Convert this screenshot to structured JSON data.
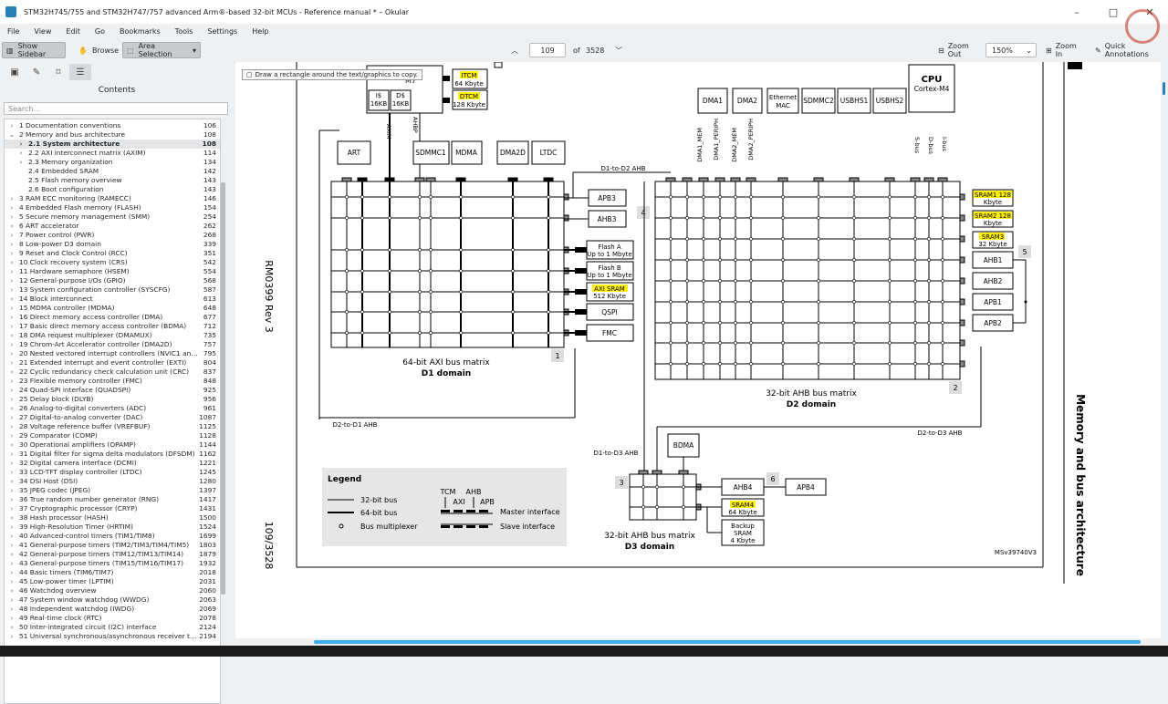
{
  "window": {
    "title": "STM32H745/755 and STM32H747/757 advanced Arm®-based 32-bit MCUs - Reference manual * – Okular",
    "minimize": "–",
    "maximize": "□",
    "close": "✕"
  },
  "menu": [
    "File",
    "View",
    "Edit",
    "Go",
    "Bookmarks",
    "Tools",
    "Settings",
    "Help"
  ],
  "toolbar": {
    "show_sidebar": "Show Sidebar",
    "browse": "Browse",
    "area_selection": "Area Selection",
    "page_current": "109",
    "page_of": "of",
    "page_total": "3528",
    "zoom_out": "Zoom Out",
    "zoom_value": "150%",
    "zoom_in": "Zoom In",
    "quick_annotations": "Quick Annotations"
  },
  "sidebar": {
    "header": "Contents",
    "search_placeholder": "Search...",
    "toc": [
      {
        "label": "1 Documentation conventions",
        "page": "106",
        "arrow": "›",
        "indent": 0
      },
      {
        "label": "2 Memory and bus architecture",
        "page": "108",
        "arrow": "⌄",
        "indent": 0
      },
      {
        "label": "2.1 System architecture",
        "page": "108",
        "arrow": "›",
        "indent": 1,
        "bold": true
      },
      {
        "label": "2.2 AXI interconnect matrix (AXIM)",
        "page": "114",
        "arrow": "›",
        "indent": 1
      },
      {
        "label": "2.3 Memory organization",
        "page": "134",
        "arrow": "›",
        "indent": 1
      },
      {
        "label": "2.4 Embedded SRAM",
        "page": "142",
        "arrow": "",
        "indent": 1
      },
      {
        "label": "2.5 Flash memory overview",
        "page": "143",
        "arrow": "",
        "indent": 1
      },
      {
        "label": "2.6 Boot configuration",
        "page": "143",
        "arrow": "",
        "indent": 1
      },
      {
        "label": "3 RAM ECC monitoring (RAMECC)",
        "page": "146",
        "arrow": "›",
        "indent": 0
      },
      {
        "label": "4 Embedded Flash memory (FLASH)",
        "page": "154",
        "arrow": "›",
        "indent": 0
      },
      {
        "label": "5 Secure memory management (SMM)",
        "page": "254",
        "arrow": "›",
        "indent": 0
      },
      {
        "label": "6 ART accelerator",
        "page": "262",
        "arrow": "›",
        "indent": 0
      },
      {
        "label": "7 Power control (PWR)",
        "page": "268",
        "arrow": "›",
        "indent": 0
      },
      {
        "label": "8 Low-power D3 domain",
        "page": "339",
        "arrow": "›",
        "indent": 0
      },
      {
        "label": "9 Reset and Clock Control (RCC)",
        "page": "351",
        "arrow": "›",
        "indent": 0
      },
      {
        "label": "10 Clock recovery system (CRS)",
        "page": "542",
        "arrow": "›",
        "indent": 0
      },
      {
        "label": "11 Hardware semaphore (HSEM)",
        "page": "554",
        "arrow": "›",
        "indent": 0
      },
      {
        "label": "12 General-purpose I/Os (GPIO)",
        "page": "568",
        "arrow": "›",
        "indent": 0
      },
      {
        "label": "13 System configuration controller (SYSCFG)",
        "page": "587",
        "arrow": "›",
        "indent": 0
      },
      {
        "label": "14 Block interconnect",
        "page": "613",
        "arrow": "›",
        "indent": 0
      },
      {
        "label": "15 MDMA controller (MDMA)",
        "page": "648",
        "arrow": "›",
        "indent": 0
      },
      {
        "label": "16 Direct memory access controller (DMA)",
        "page": "677",
        "arrow": "›",
        "indent": 0
      },
      {
        "label": "17 Basic direct memory access controller (BDMA)",
        "page": "712",
        "arrow": "›",
        "indent": 0
      },
      {
        "label": "18 DMA request multiplexer (DMAMUX)",
        "page": "735",
        "arrow": "›",
        "indent": 0
      },
      {
        "label": "19 Chrom-Art Accelerator controller (DMA2D)",
        "page": "757",
        "arrow": "›",
        "indent": 0
      },
      {
        "label": "20 Nested vectored interrupt controllers (NVIC1 and ...",
        "page": "795",
        "arrow": "›",
        "indent": 0
      },
      {
        "label": "21 Extended interrupt and event controller (EXTI)",
        "page": "804",
        "arrow": "›",
        "indent": 0
      },
      {
        "label": "22 Cyclic redundancy check calculation unit (CRC)",
        "page": "837",
        "arrow": "›",
        "indent": 0
      },
      {
        "label": "23 Flexible memory controller (FMC)",
        "page": "848",
        "arrow": "›",
        "indent": 0
      },
      {
        "label": "24 Quad-SPI interface (QUADSPI)",
        "page": "925",
        "arrow": "›",
        "indent": 0
      },
      {
        "label": "25 Delay block (DLYB)",
        "page": "956",
        "arrow": "›",
        "indent": 0
      },
      {
        "label": "26 Analog-to-digital converters (ADC)",
        "page": "961",
        "arrow": "›",
        "indent": 0
      },
      {
        "label": "27 Digital-to-analog converter (DAC)",
        "page": "1087",
        "arrow": "›",
        "indent": 0
      },
      {
        "label": "28 Voltage reference buffer (VREFBUF)",
        "page": "1125",
        "arrow": "›",
        "indent": 0
      },
      {
        "label": "29 Comparator (COMP)",
        "page": "1128",
        "arrow": "›",
        "indent": 0
      },
      {
        "label": "30 Operational amplifiers (OPAMP)",
        "page": "1144",
        "arrow": "›",
        "indent": 0
      },
      {
        "label": "31 Digital filter for sigma delta modulators (DFSDM)",
        "page": "1162",
        "arrow": "›",
        "indent": 0
      },
      {
        "label": "32 Digital camera interface (DCMI)",
        "page": "1221",
        "arrow": "›",
        "indent": 0
      },
      {
        "label": "33 LCD-TFT display controller (LTDC)",
        "page": "1245",
        "arrow": "›",
        "indent": 0
      },
      {
        "label": "34 DSI Host (DSI)",
        "page": "1280",
        "arrow": "›",
        "indent": 0
      },
      {
        "label": "35 JPEG codec (JPEG)",
        "page": "1397",
        "arrow": "›",
        "indent": 0
      },
      {
        "label": "36 True random number generator (RNG)",
        "page": "1417",
        "arrow": "›",
        "indent": 0
      },
      {
        "label": "37 Cryptographic processor (CRYP)",
        "page": "1431",
        "arrow": "›",
        "indent": 0
      },
      {
        "label": "38 Hash processor (HASH)",
        "page": "1500",
        "arrow": "›",
        "indent": 0
      },
      {
        "label": "39 High-Resolution Timer (HRTIM)",
        "page": "1524",
        "arrow": "›",
        "indent": 0
      },
      {
        "label": "40 Advanced-control timers (TIM1/TIM8)",
        "page": "1699",
        "arrow": "›",
        "indent": 0
      },
      {
        "label": "41 General-purpose timers (TIM2/TIM3/TIM4/TIM5)",
        "page": "1803",
        "arrow": "›",
        "indent": 0
      },
      {
        "label": "42 General-purpose timers (TIM12/TIM13/TIM14)",
        "page": "1879",
        "arrow": "›",
        "indent": 0
      },
      {
        "label": "43 General-purpose timers (TIM15/TIM16/TIM17)",
        "page": "1932",
        "arrow": "›",
        "indent": 0
      },
      {
        "label": "44 Basic timers (TIM6/TIM7)",
        "page": "2018",
        "arrow": "›",
        "indent": 0
      },
      {
        "label": "45 Low-power timer (LPTIM)",
        "page": "2031",
        "arrow": "›",
        "indent": 0
      },
      {
        "label": "46 Watchdog overview",
        "page": "2060",
        "arrow": "›",
        "indent": 0
      },
      {
        "label": "47 System window watchdog (WWDG)",
        "page": "2063",
        "arrow": "›",
        "indent": 0
      },
      {
        "label": "48 Independent watchdog (IWDG)",
        "page": "2069",
        "arrow": "›",
        "indent": 0
      },
      {
        "label": "49 Real-time clock (RTC)",
        "page": "2078",
        "arrow": "›",
        "indent": 0
      },
      {
        "label": "50 Inter-integrated circuit (I2C) interface",
        "page": "2124",
        "arrow": "›",
        "indent": 0
      },
      {
        "label": "51 Universal synchronous/asynchronous receiver tra...",
        "page": "2194",
        "arrow": "›",
        "indent": 0
      }
    ]
  },
  "tooltip": "Draw a rectangle around the text/graphics to copy.",
  "document": {
    "margin_left_top": "RM0399 Rev 3",
    "margin_left_bottom": "109/3528",
    "margin_right": "Memory and bus architecture",
    "diagram_id": "MSv39740V3",
    "cpu_m7": "M7",
    "itcm": "ITCM",
    "itcm_size": "64 Kbyte",
    "dtcm": "DTCM",
    "dtcm_size": "128 Kbyte",
    "icache": "I$",
    "icache_size": "16KB",
    "dcache": "D$",
    "dcache_size": "16KB",
    "axim": "AXIM",
    "ahbp": "AHBP",
    "art": "ART",
    "sdmmc1": "SDMMC1",
    "mdma": "MDMA",
    "dma2d": "DMA2D",
    "ltdc": "LTDC",
    "apb3": "APB3",
    "ahb3": "AHB3",
    "flash_a": "Flash A",
    "flash_a_size": "Up to 1 Mbyte",
    "flash_b": "Flash B",
    "flash_b_size": "Up to 1 Mbyte",
    "axi_sram": "AXI SRAM",
    "axi_sram_size": "512 Kbyte",
    "qspi": "QSPI",
    "fmc": "FMC",
    "d1_title": "64-bit AXI bus matrix",
    "d1_domain": "D1 domain",
    "d1_to_d2": "D1-to-D2 AHB",
    "d2_to_d1": "D2-to-D1 AHB",
    "d1_to_d3": "D1-to-D3 AHB",
    "d2_to_d3": "D2-to-D3 AHB",
    "dma1": "DMA1",
    "dma2": "DMA2",
    "eth1": "Ethernet",
    "eth2": "MAC",
    "sdmmc2": "SDMMC2",
    "usbhs1": "USBHS1",
    "usbhs2": "USBHS2",
    "cpu": "CPU",
    "cortex_m4": "Cortex-M4",
    "dma1_mem": "DMA1_MEM",
    "dma1_periph": "DMA1_PERIPH",
    "dma2_mem": "DMA2_MEM",
    "dma2_periph": "DMA2_PERIPH",
    "sbus": "S-bus",
    "dbus": "D-bus",
    "ibus": "I-bus",
    "sram1": "SRAM1 128",
    "sram2": "SRAM2 128",
    "sram3": "SRAM3",
    "kbyte": "Kbyte",
    "sram3_size": "32 Kbyte",
    "ahb1": "AHB1",
    "ahb2": "AHB2",
    "apb1": "APB1",
    "apb2": "APB2",
    "d2_title": "32-bit AHB bus matrix",
    "d2_domain": "D2 domain",
    "bdma": "BDMA",
    "ahb4": "AHB4",
    "apb4": "APB4",
    "sram4": "SRAM4",
    "sram4_size": "64 Kbyte",
    "backup1": "Backup",
    "backup2": "SRAM",
    "backup3": "4 Kbyte",
    "d3_title": "32-bit AHB bus matrix",
    "d3_domain": "D3 domain",
    "n1": "1",
    "n2": "2",
    "n3": "3",
    "n4": "4",
    "n5": "5",
    "n6": "6",
    "legend_title": "Legend",
    "legend_32": "32-bit bus",
    "legend_64": "64-bit bus",
    "legend_mux": "Bus multiplexer",
    "legend_tcm": "TCM",
    "legend_ahb": "AHB",
    "legend_axi": "AXI",
    "legend_apb": "APB",
    "legend_master": "Master interface",
    "legend_slave": "Slave interface"
  },
  "colors": {
    "highlight": "#fff200",
    "accent": "#3daee9"
  }
}
